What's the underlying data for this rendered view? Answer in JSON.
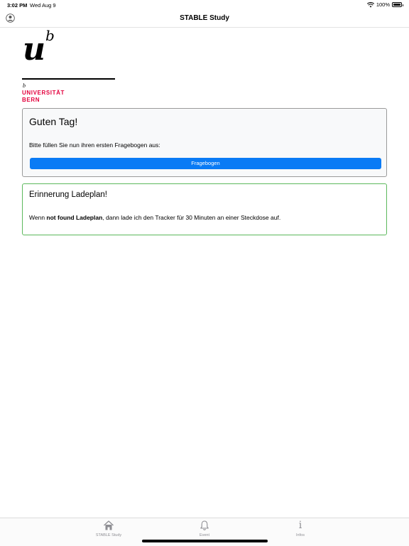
{
  "status_bar": {
    "time": "3:02 PM",
    "date": "Wed Aug 9",
    "battery": "100%",
    "battery_level": 1.0
  },
  "nav": {
    "title": "STABLE Study"
  },
  "logo": {
    "mark_u": "u",
    "mark_b": "b",
    "small_b": "b",
    "line1": "UNIVERSITÄT",
    "line2": "BERN"
  },
  "welcome_card": {
    "title": "Guten Tag!",
    "text": "Bitte füllen Sie nun ihren ersten Fragebogen aus:",
    "button_label": "Fragebogen"
  },
  "reminder_card": {
    "title": "Erinnerung Ladeplan!",
    "text_before": "Wenn ",
    "text_bold": "not found Ladeplan",
    "text_after": ", dann lade ich den Tracker für 30 Minuten an einer Steckdose auf."
  },
  "tabs": [
    {
      "label": "STABLE Study",
      "icon": "home-icon"
    },
    {
      "label": "Event",
      "icon": "bell-icon"
    },
    {
      "label": "Infos",
      "icon": "info-icon"
    }
  ],
  "colors": {
    "primary": "#0a7bf5",
    "success_border": "#5cb85c",
    "uni_red": "#e3003d",
    "tab_gray": "#8e8e93"
  }
}
